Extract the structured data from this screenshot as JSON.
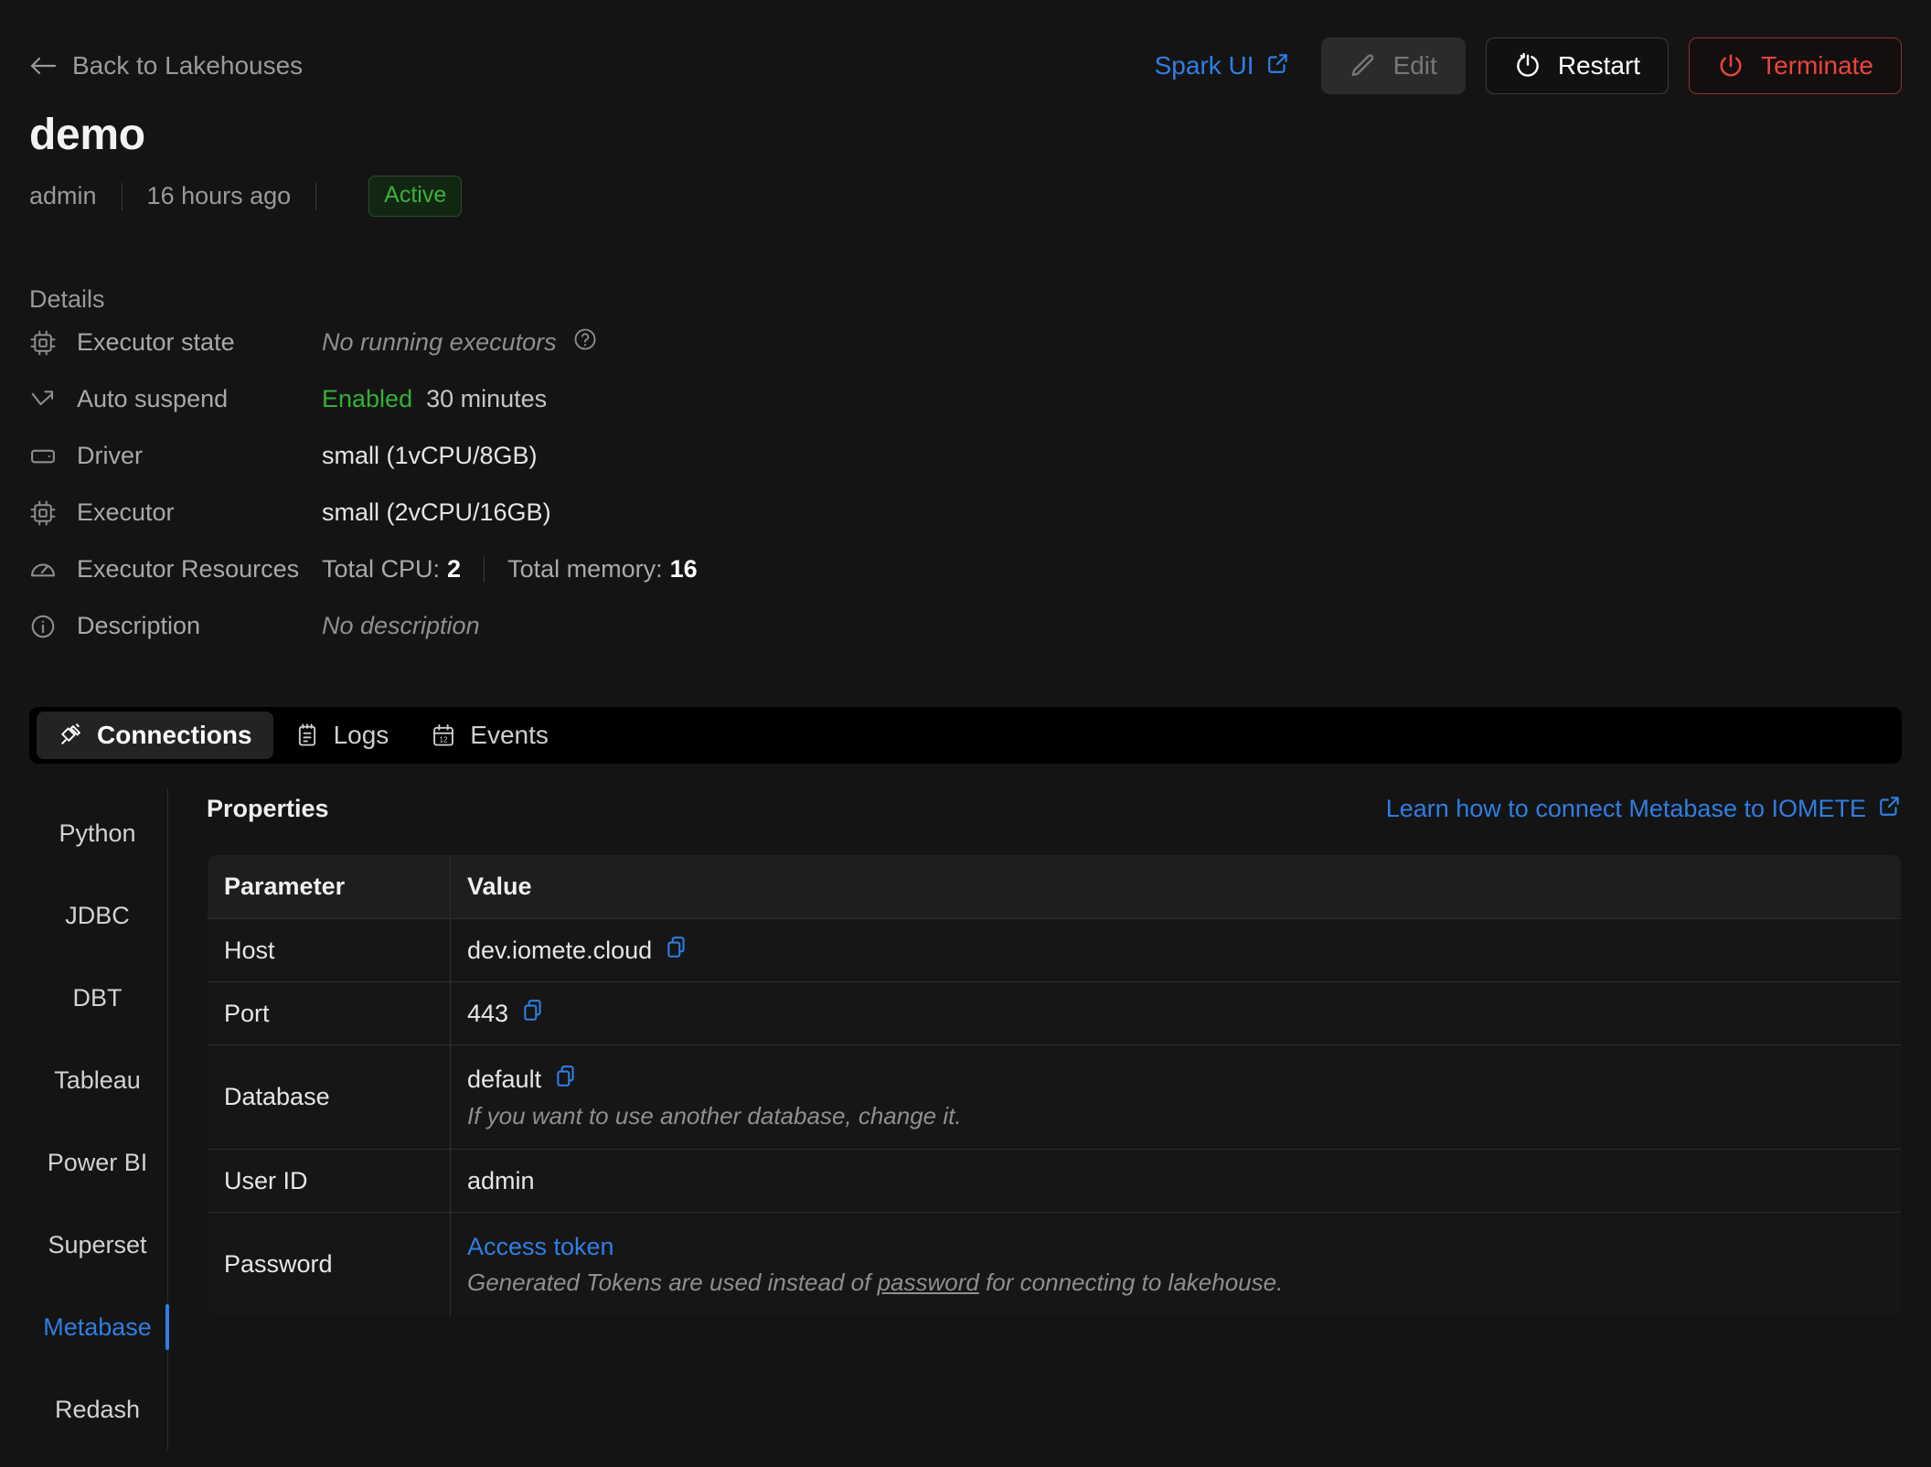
{
  "header": {
    "back_label": "Back to Lakehouses",
    "back_icon": "arrow-left-icon",
    "spark_ui_label": "Spark UI",
    "spark_ui_icon": "external-link-icon",
    "edit_label": "Edit",
    "edit_icon": "pencil-icon",
    "restart_label": "Restart",
    "restart_icon": "power-restart-icon",
    "terminate_label": "Terminate",
    "terminate_icon": "power-icon",
    "accent_blue": "#2f7ee3",
    "danger_red": "#e8453c"
  },
  "title": {
    "name": "demo",
    "owner": "admin",
    "updated": "16 hours ago",
    "status": "Active",
    "status_color": "#3fae3f"
  },
  "details": {
    "heading": "Details",
    "rows": [
      {
        "icon": "cpu-chip-icon",
        "label": "Executor state",
        "value": "No running executors",
        "style": "italic-muted",
        "help_icon": "question-circle-icon"
      },
      {
        "icon": "arrow-down-right-icon",
        "label": "Auto suspend",
        "value": "Enabled",
        "value2": "30 minutes",
        "style": "green"
      },
      {
        "icon": "driver-card-icon",
        "label": "Driver",
        "value": "small (1vCPU/8GB)",
        "style": "plain"
      },
      {
        "icon": "cpu-chip-icon",
        "label": "Executor",
        "value": "small (2vCPU/16GB)",
        "style": "plain"
      },
      {
        "icon": "gauge-icon",
        "label": "Executor Resources",
        "cpu_label": "Total CPU:",
        "cpu_value": "2",
        "mem_label": "Total memory:",
        "mem_value": "16",
        "style": "resources"
      },
      {
        "icon": "info-circle-icon",
        "label": "Description",
        "value": "No description",
        "style": "italic-muted"
      }
    ]
  },
  "tabs": [
    {
      "label": "Connections",
      "icon": "plug-icon",
      "active": true
    },
    {
      "label": "Logs",
      "icon": "notepad-icon",
      "active": false
    },
    {
      "label": "Events",
      "icon": "calendar-icon",
      "active": false
    }
  ],
  "connections": {
    "sidebar": [
      {
        "label": "Python",
        "active": false
      },
      {
        "label": "JDBC",
        "active": false
      },
      {
        "label": "DBT",
        "active": false
      },
      {
        "label": "Tableau",
        "active": false
      },
      {
        "label": "Power BI",
        "active": false
      },
      {
        "label": "Superset",
        "active": false
      },
      {
        "label": "Metabase",
        "active": true
      },
      {
        "label": "Redash",
        "active": false
      }
    ],
    "properties_title": "Properties",
    "learn_link": "Learn how to connect Metabase to IOMETE",
    "learn_link_icon": "external-link-icon",
    "table": {
      "columns": [
        "Parameter",
        "Value"
      ],
      "rows": [
        {
          "parameter": "Host",
          "value": "dev.iomete.cloud",
          "copy": true
        },
        {
          "parameter": "Port",
          "value": "443",
          "copy": true
        },
        {
          "parameter": "Database",
          "value": "default",
          "copy": true,
          "note": "If you want to use another database, change it."
        },
        {
          "parameter": "User ID",
          "value": "admin",
          "copy": false
        },
        {
          "parameter": "Password",
          "link_value": "Access token",
          "note_pre": "Generated Tokens are used instead of ",
          "note_underline": "password",
          "note_post": " for connecting to lakehouse."
        }
      ]
    }
  }
}
